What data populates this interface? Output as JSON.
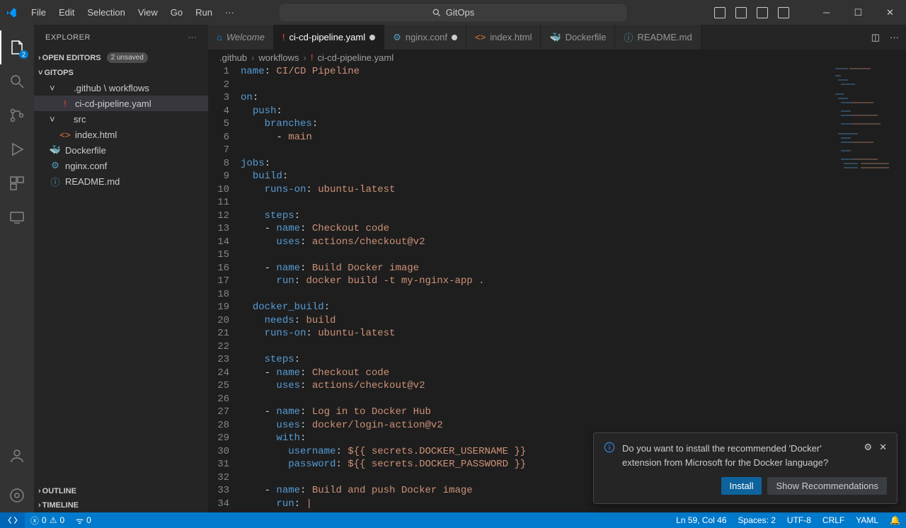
{
  "menu": [
    "File",
    "Edit",
    "Selection",
    "View",
    "Go",
    "Run",
    "···"
  ],
  "search_placeholder": "GitOps",
  "activity_badge": "2",
  "sidebar": {
    "title": "EXPLORER",
    "sections": {
      "open_editors": {
        "label": "OPEN EDITORS",
        "badge": "2 unsaved"
      },
      "project": {
        "label": "GITOPS"
      },
      "outline": {
        "label": "OUTLINE"
      },
      "timeline": {
        "label": "TIMELINE"
      }
    },
    "tree": [
      {
        "type": "folder",
        "depth": 1,
        "chev": "˅",
        "icon": "",
        "label": ".github \\ workflows"
      },
      {
        "type": "file",
        "depth": 2,
        "icon": "!",
        "iconColor": "#e74c3c",
        "label": "ci-cd-pipeline.yaml",
        "selected": true
      },
      {
        "type": "folder",
        "depth": 1,
        "chev": "˅",
        "icon": "",
        "label": "src"
      },
      {
        "type": "file",
        "depth": 2,
        "icon": "<>",
        "iconColor": "#e37933",
        "label": "index.html"
      },
      {
        "type": "file",
        "depth": 1,
        "icon": "🐳",
        "iconColor": "#0db7ed",
        "label": "Dockerfile"
      },
      {
        "type": "file",
        "depth": 1,
        "icon": "⚙",
        "iconColor": "#519aba",
        "label": "nginx.conf"
      },
      {
        "type": "file",
        "depth": 1,
        "icon": "ⓘ",
        "iconColor": "#519aba",
        "label": "README.md"
      }
    ]
  },
  "tabs": [
    {
      "icon": "⌂",
      "iconColor": "#0098ff",
      "label": "Welcome",
      "italic": true,
      "dirty": false,
      "showClose": false
    },
    {
      "icon": "!",
      "iconColor": "#e74c3c",
      "label": "ci-cd-pipeline.yaml",
      "active": true,
      "dirty": true
    },
    {
      "icon": "⚙",
      "iconColor": "#519aba",
      "label": "nginx.conf",
      "dirty": true
    },
    {
      "icon": "<>",
      "iconColor": "#e37933",
      "label": "index.html",
      "showClose": false
    },
    {
      "icon": "🐳",
      "iconColor": "#0db7ed",
      "label": "Dockerfile",
      "showClose": false
    },
    {
      "icon": "ⓘ",
      "iconColor": "#519aba",
      "label": "README.md",
      "showClose": false
    }
  ],
  "breadcrumb": [
    ".github",
    "workflows",
    "ci-cd-pipeline.yaml"
  ],
  "breadcrumb_icon": {
    "glyph": "!",
    "color": "#e74c3c"
  },
  "code_lines": [
    [
      {
        "t": "name",
        "c": "kw"
      },
      {
        "t": ": ",
        "c": "pun"
      },
      {
        "t": "CI/CD Pipeline",
        "c": "str"
      }
    ],
    [],
    [
      {
        "t": "on",
        "c": "kw"
      },
      {
        "t": ":",
        "c": "pun"
      }
    ],
    [
      {
        "t": "  ",
        "c": "pun"
      },
      {
        "t": "push",
        "c": "kw"
      },
      {
        "t": ":",
        "c": "pun"
      }
    ],
    [
      {
        "t": "    ",
        "c": "pun"
      },
      {
        "t": "branches",
        "c": "kw"
      },
      {
        "t": ":",
        "c": "pun"
      }
    ],
    [
      {
        "t": "      - ",
        "c": "pun"
      },
      {
        "t": "main",
        "c": "str"
      }
    ],
    [],
    [
      {
        "t": "jobs",
        "c": "kw"
      },
      {
        "t": ":",
        "c": "pun"
      }
    ],
    [
      {
        "t": "  ",
        "c": "pun"
      },
      {
        "t": "build",
        "c": "kw"
      },
      {
        "t": ":",
        "c": "pun"
      }
    ],
    [
      {
        "t": "    ",
        "c": "pun"
      },
      {
        "t": "runs-on",
        "c": "kw"
      },
      {
        "t": ": ",
        "c": "pun"
      },
      {
        "t": "ubuntu-latest",
        "c": "str"
      }
    ],
    [],
    [
      {
        "t": "    ",
        "c": "pun"
      },
      {
        "t": "steps",
        "c": "kw"
      },
      {
        "t": ":",
        "c": "pun"
      }
    ],
    [
      {
        "t": "    - ",
        "c": "pun"
      },
      {
        "t": "name",
        "c": "kw"
      },
      {
        "t": ": ",
        "c": "pun"
      },
      {
        "t": "Checkout code",
        "c": "str"
      }
    ],
    [
      {
        "t": "      ",
        "c": "pun"
      },
      {
        "t": "uses",
        "c": "kw"
      },
      {
        "t": ": ",
        "c": "pun"
      },
      {
        "t": "actions/checkout@v2",
        "c": "str"
      }
    ],
    [],
    [
      {
        "t": "    - ",
        "c": "pun"
      },
      {
        "t": "name",
        "c": "kw"
      },
      {
        "t": ": ",
        "c": "pun"
      },
      {
        "t": "Build Docker image",
        "c": "str"
      }
    ],
    [
      {
        "t": "      ",
        "c": "pun"
      },
      {
        "t": "run",
        "c": "kw"
      },
      {
        "t": ": ",
        "c": "pun"
      },
      {
        "t": "docker build -t my-nginx-app .",
        "c": "str"
      }
    ],
    [],
    [
      {
        "t": "  ",
        "c": "pun"
      },
      {
        "t": "docker_build",
        "c": "kw"
      },
      {
        "t": ":",
        "c": "pun"
      }
    ],
    [
      {
        "t": "    ",
        "c": "pun"
      },
      {
        "t": "needs",
        "c": "kw"
      },
      {
        "t": ": ",
        "c": "pun"
      },
      {
        "t": "build",
        "c": "str"
      }
    ],
    [
      {
        "t": "    ",
        "c": "pun"
      },
      {
        "t": "runs-on",
        "c": "kw"
      },
      {
        "t": ": ",
        "c": "pun"
      },
      {
        "t": "ubuntu-latest",
        "c": "str"
      }
    ],
    [],
    [
      {
        "t": "    ",
        "c": "pun"
      },
      {
        "t": "steps",
        "c": "kw"
      },
      {
        "t": ":",
        "c": "pun"
      }
    ],
    [
      {
        "t": "    - ",
        "c": "pun"
      },
      {
        "t": "name",
        "c": "kw"
      },
      {
        "t": ": ",
        "c": "pun"
      },
      {
        "t": "Checkout code",
        "c": "str"
      }
    ],
    [
      {
        "t": "      ",
        "c": "pun"
      },
      {
        "t": "uses",
        "c": "kw"
      },
      {
        "t": ": ",
        "c": "pun"
      },
      {
        "t": "actions/checkout@v2",
        "c": "str"
      }
    ],
    [],
    [
      {
        "t": "    - ",
        "c": "pun"
      },
      {
        "t": "name",
        "c": "kw"
      },
      {
        "t": ": ",
        "c": "pun"
      },
      {
        "t": "Log in to Docker Hub",
        "c": "str"
      }
    ],
    [
      {
        "t": "      ",
        "c": "pun"
      },
      {
        "t": "uses",
        "c": "kw"
      },
      {
        "t": ": ",
        "c": "pun"
      },
      {
        "t": "docker/login-action@v2",
        "c": "str"
      }
    ],
    [
      {
        "t": "      ",
        "c": "pun"
      },
      {
        "t": "with",
        "c": "kw"
      },
      {
        "t": ":",
        "c": "pun"
      }
    ],
    [
      {
        "t": "        ",
        "c": "pun"
      },
      {
        "t": "username",
        "c": "kw"
      },
      {
        "t": ": ",
        "c": "pun"
      },
      {
        "t": "${{ secrets.DOCKER_USERNAME }}",
        "c": "str"
      }
    ],
    [
      {
        "t": "        ",
        "c": "pun"
      },
      {
        "t": "password",
        "c": "kw"
      },
      {
        "t": ": ",
        "c": "pun"
      },
      {
        "t": "${{ secrets.DOCKER_PASSWORD }}",
        "c": "str"
      }
    ],
    [],
    [
      {
        "t": "    - ",
        "c": "pun"
      },
      {
        "t": "name",
        "c": "kw"
      },
      {
        "t": ": ",
        "c": "pun"
      },
      {
        "t": "Build and push Docker image",
        "c": "str"
      }
    ],
    [
      {
        "t": "      ",
        "c": "pun"
      },
      {
        "t": "run",
        "c": "kw"
      },
      {
        "t": ": ",
        "c": "pun"
      },
      {
        "t": "|",
        "c": "str"
      }
    ]
  ],
  "notification": {
    "message": "Do you want to install the recommended 'Docker' extension from Microsoft for the Docker language?",
    "primary": "Install",
    "secondary": "Show Recommendations"
  },
  "status": {
    "errors": "0",
    "warnings": "0",
    "ports": "0",
    "cursor": "Ln 59, Col 46",
    "spaces": "Spaces: 2",
    "encoding": "UTF-8",
    "eol": "CRLF",
    "lang": "YAML"
  }
}
